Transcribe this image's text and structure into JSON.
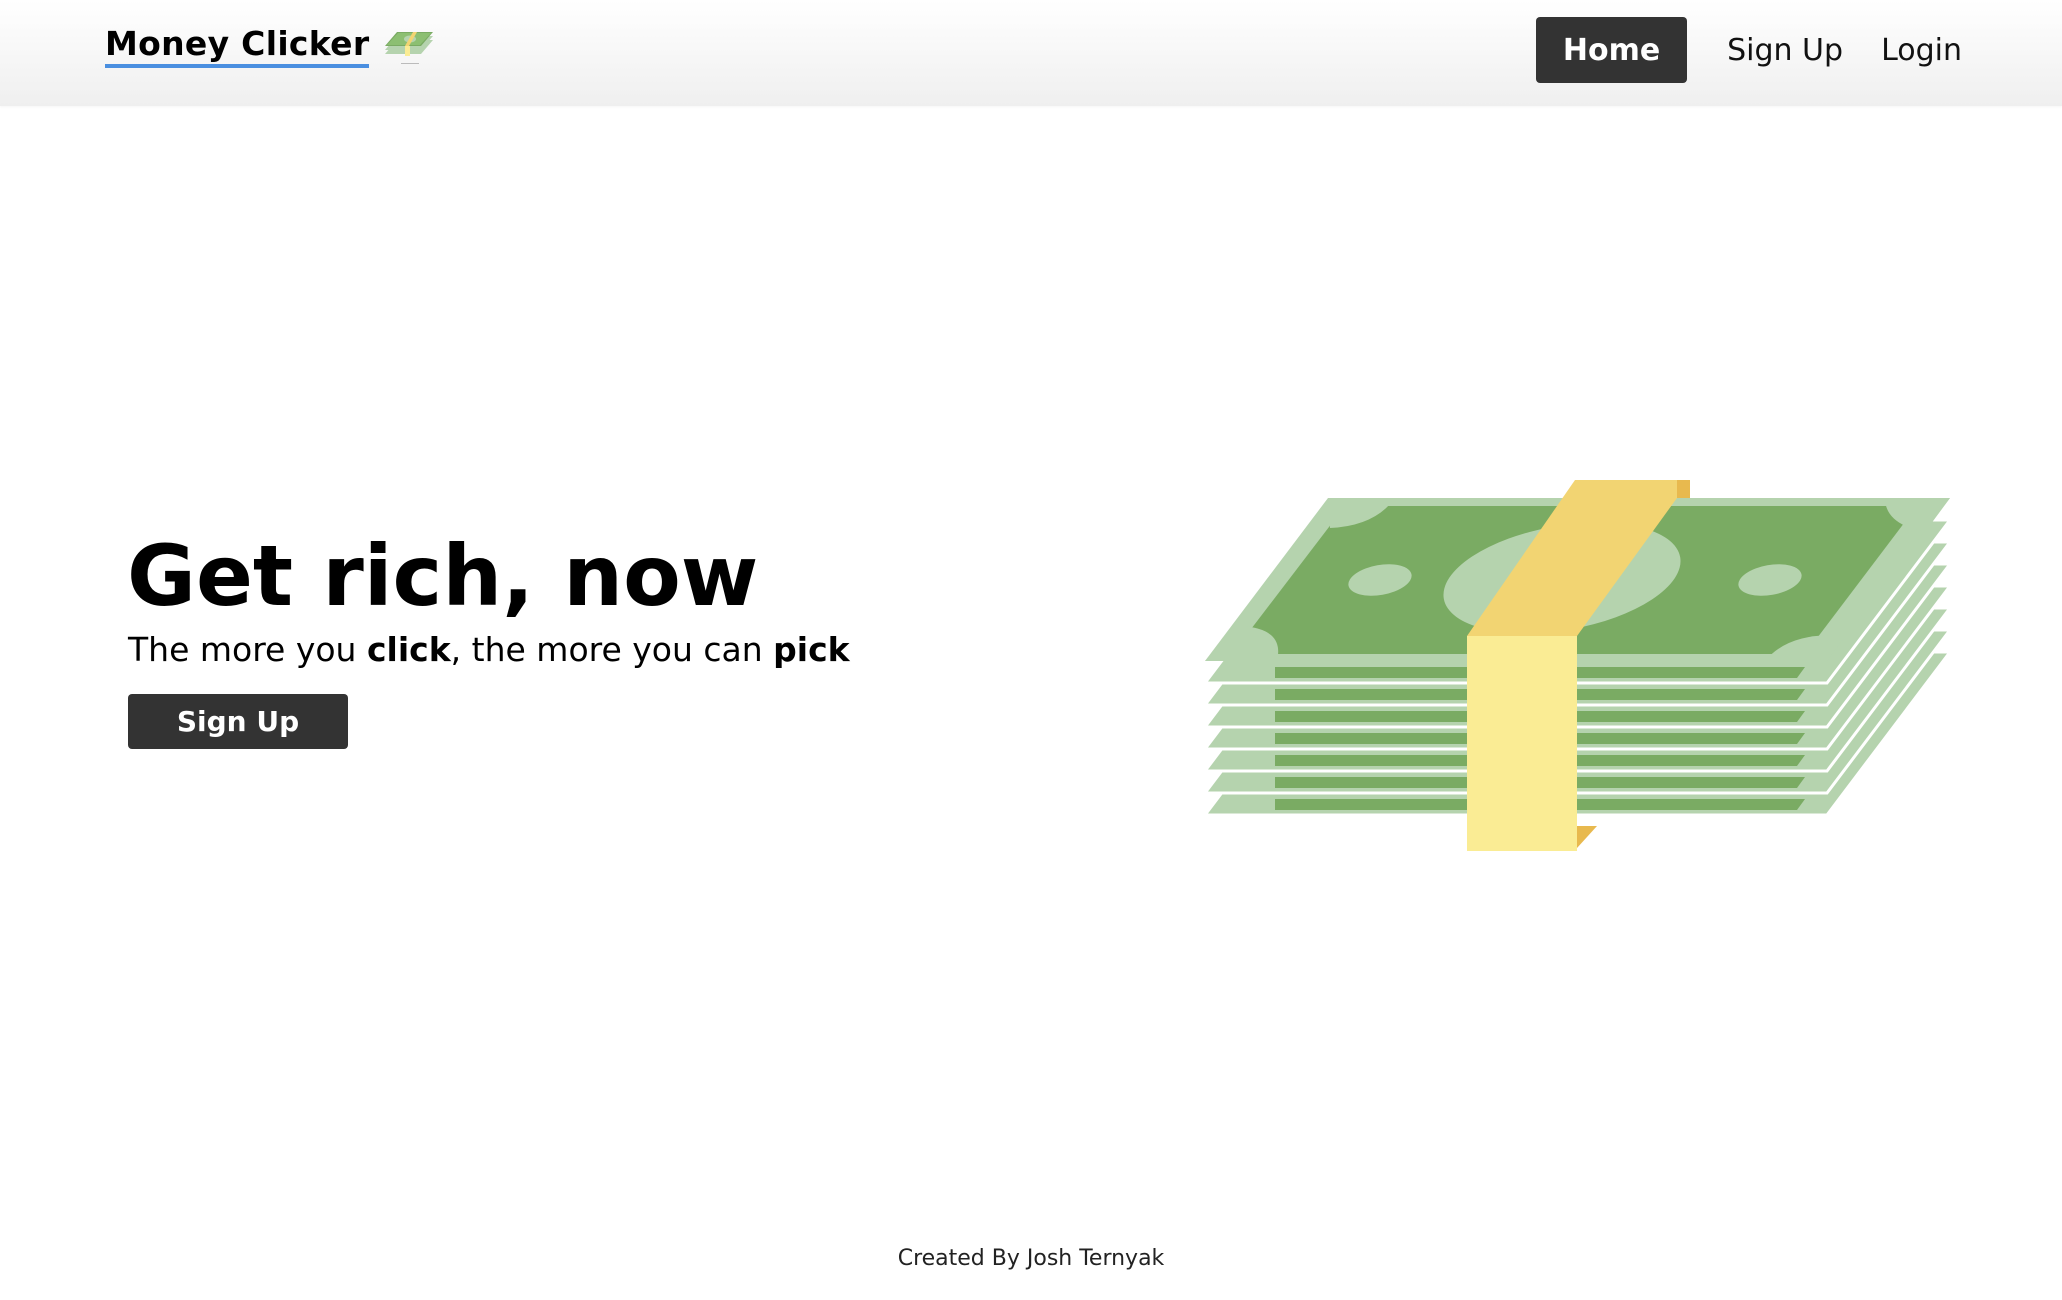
{
  "navbar": {
    "brand": "Money Clicker",
    "brand_icon": "money-stack-icon",
    "links": {
      "home": "Home",
      "signup": "Sign Up",
      "login": "Login"
    }
  },
  "hero": {
    "title_part1": "Get rich,",
    "title_part2": "now",
    "subtitle": {
      "a": "The more you ",
      "b": "click",
      "c": ", the more you can ",
      "d": "pick"
    },
    "button": "Sign Up",
    "illustration": "money-stack-illustration"
  },
  "footer": {
    "text": "Created By Josh Ternyak"
  },
  "colors": {
    "dark_button": "#333333",
    "brand_underline": "#4a8fe0",
    "bill_green": "#7aab63",
    "bill_light": "#b5d3ae",
    "band_yellow": "#f2d472",
    "band_light": "#faec94"
  }
}
